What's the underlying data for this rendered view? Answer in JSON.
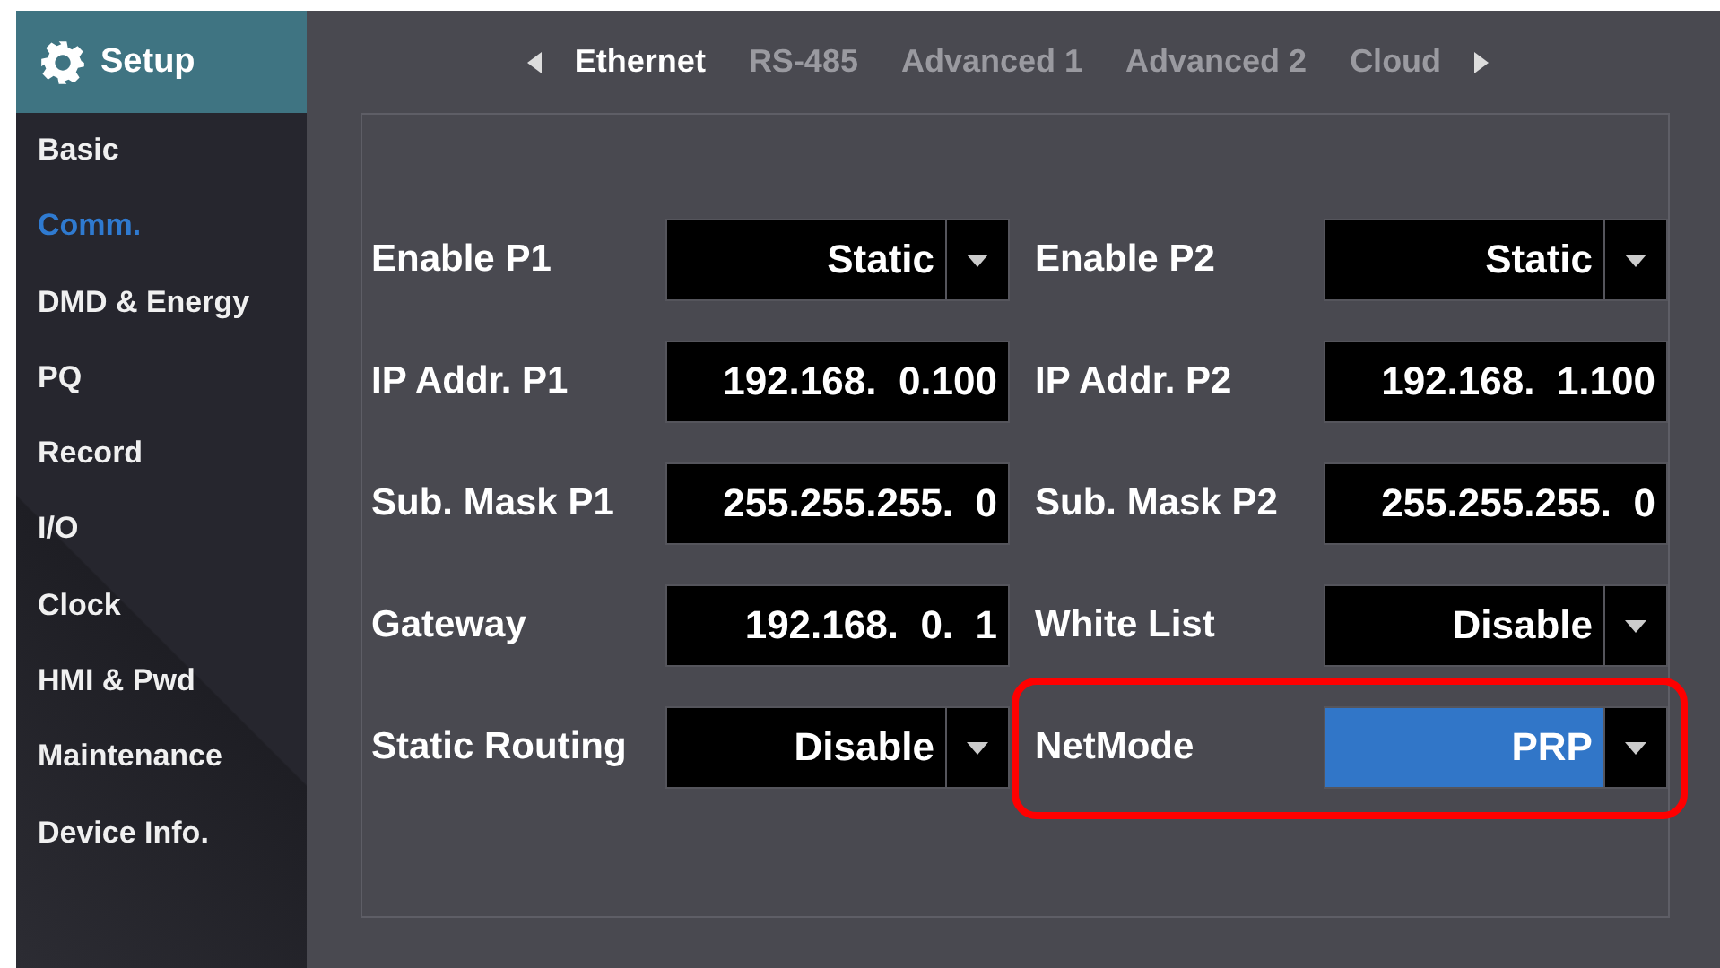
{
  "sidebar": {
    "title": "Setup",
    "items": [
      {
        "label": "Basic",
        "selected": false
      },
      {
        "label": "Comm.",
        "selected": true
      },
      {
        "label": "DMD & Energy",
        "selected": false
      },
      {
        "label": "PQ",
        "selected": false
      },
      {
        "label": "Record",
        "selected": false
      },
      {
        "label": "I/O",
        "selected": false
      },
      {
        "label": "Clock",
        "selected": false
      },
      {
        "label": "HMI & Pwd",
        "selected": false
      },
      {
        "label": "Maintenance",
        "selected": false
      },
      {
        "label": "Device Info.",
        "selected": false
      }
    ]
  },
  "tabs": [
    {
      "label": "Ethernet",
      "selected": true
    },
    {
      "label": "RS-485",
      "selected": false
    },
    {
      "label": "Advanced 1",
      "selected": false
    },
    {
      "label": "Advanced 2",
      "selected": false
    },
    {
      "label": "Cloud",
      "selected": false
    }
  ],
  "rows": [
    {
      "fields": [
        {
          "label": "Enable P1",
          "value": "Static",
          "kind": "dropdown",
          "focused": false,
          "highlighted": false
        },
        {
          "label": "Enable P2",
          "value": "Static",
          "kind": "dropdown",
          "focused": false,
          "highlighted": false
        }
      ]
    },
    {
      "fields": [
        {
          "label": "IP Addr. P1",
          "value": "192.168.  0.100",
          "kind": "text",
          "focused": false,
          "highlighted": false
        },
        {
          "label": "IP Addr. P2",
          "value": "192.168.  1.100",
          "kind": "text",
          "focused": false,
          "highlighted": false
        }
      ]
    },
    {
      "fields": [
        {
          "label": "Sub. Mask P1",
          "value": "255.255.255.  0",
          "kind": "text",
          "focused": false,
          "highlighted": false
        },
        {
          "label": "Sub. Mask P2",
          "value": "255.255.255.  0",
          "kind": "text",
          "focused": false,
          "highlighted": false
        }
      ]
    },
    {
      "fields": [
        {
          "label": "Gateway",
          "value": "192.168.  0.  1",
          "kind": "text",
          "focused": false,
          "highlighted": false
        },
        {
          "label": "White List",
          "value": "Disable",
          "kind": "dropdown",
          "focused": false,
          "highlighted": false
        }
      ]
    },
    {
      "fields": [
        {
          "label": "Static Routing",
          "value": "Disable",
          "kind": "dropdown",
          "focused": false,
          "highlighted": false
        },
        {
          "label": "NetMode",
          "value": "PRP",
          "kind": "dropdown",
          "focused": true,
          "highlighted": true
        }
      ]
    }
  ]
}
